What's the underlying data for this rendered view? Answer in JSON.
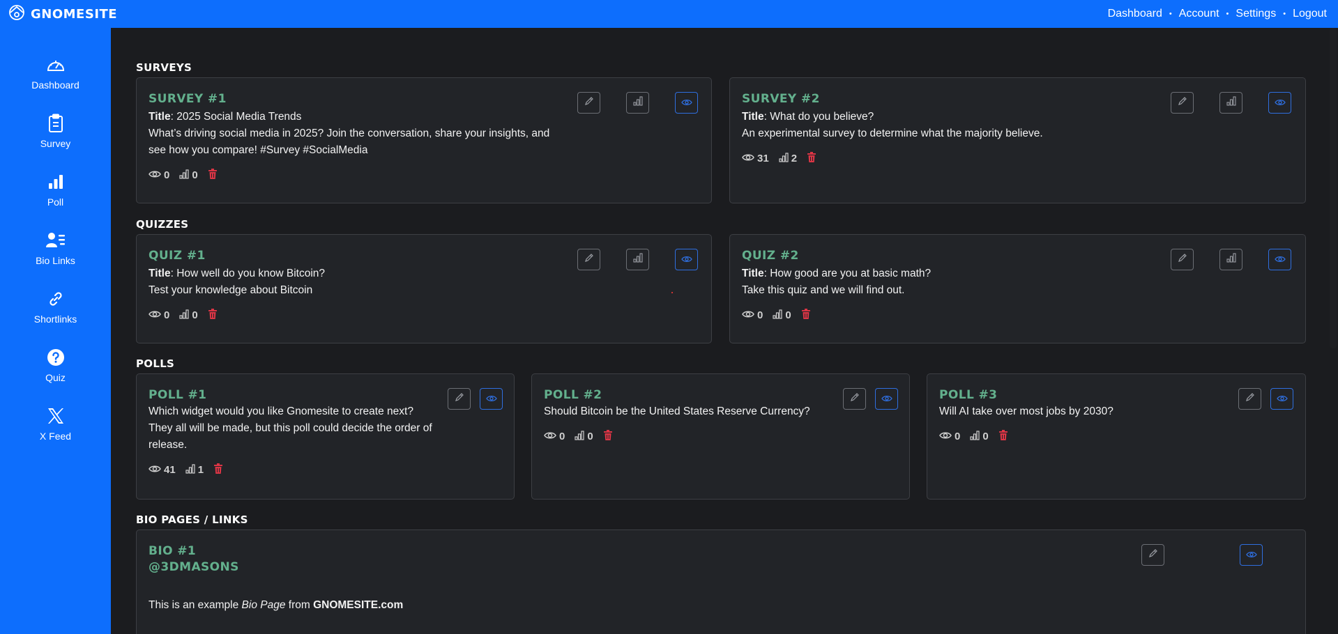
{
  "app": {
    "brand": "GNOMESITE"
  },
  "topnav": {
    "items": [
      "Dashboard",
      "Account",
      "Settings",
      "Logout"
    ],
    "separator": "•"
  },
  "sidebar": {
    "items": [
      {
        "label": "Dashboard",
        "icon": "speedometer-icon"
      },
      {
        "label": "Survey",
        "icon": "clipboard-icon"
      },
      {
        "label": "Poll",
        "icon": "bar-chart-icon"
      },
      {
        "label": "Bio Links",
        "icon": "person-lines-icon"
      },
      {
        "label": "Shortlinks",
        "icon": "link-icon"
      },
      {
        "label": "Quiz",
        "icon": "question-circle-icon"
      },
      {
        "label": "X Feed",
        "icon": "x-logo-icon"
      }
    ]
  },
  "sections": {
    "surveys": "SURVEYS",
    "quizzes": "QUIZZES",
    "polls": "POLLS",
    "bio": "BIO PAGES / LINKS"
  },
  "surveys": [
    {
      "title": "SURVEY #1",
      "title_label": "Title",
      "title_value": ": 2025 Social Media Trends",
      "desc": "What’s driving social media in 2025? Join the conversation, share your insights, and see how you compare! #Survey #SocialMedia",
      "views": "0",
      "responses": "0"
    },
    {
      "title": "SURVEY #2",
      "title_label": "Title",
      "title_value": ": What do you believe?",
      "desc": "An experimental survey to determine what the majority believe.",
      "views": "31",
      "responses": "2"
    }
  ],
  "quizzes": [
    {
      "title": "QUIZ #1",
      "title_label": "Title",
      "title_value": ": How well do you know Bitcoin?",
      "desc": "Test your knowledge about Bitcoin",
      "views": "0",
      "responses": "0"
    },
    {
      "title": "QUIZ #2",
      "title_label": "Title",
      "title_value": ": How good are you at basic math?",
      "desc": "Take this quiz and we will find out.",
      "views": "0",
      "responses": "0"
    }
  ],
  "polls": [
    {
      "title": "POLL #1",
      "line1": "Which widget would you like Gnomesite to create next?",
      "line2": "They all will be made, but this poll could decide the order of release.",
      "views": "41",
      "responses": "1"
    },
    {
      "title": "POLL #2",
      "line1": "Should Bitcoin be the United States Reserve Currency?",
      "views": "0",
      "responses": "0"
    },
    {
      "title": "POLL #3",
      "line1": "Will AI take over most jobs by 2030?",
      "views": "0",
      "responses": "0"
    }
  ],
  "bio": [
    {
      "title": "BIO #1",
      "handle": "@3DMASONS",
      "text_pre": "This is an example ",
      "text_em": "Bio Page",
      "text_mid": " from ",
      "text_bold": "GNOMESITE.com"
    }
  ],
  "colors": {
    "accent": "#0d6efd",
    "card_title": "#63b08d",
    "delete": "#dc3545",
    "background": "#1b1c1f",
    "card": "#222428"
  }
}
